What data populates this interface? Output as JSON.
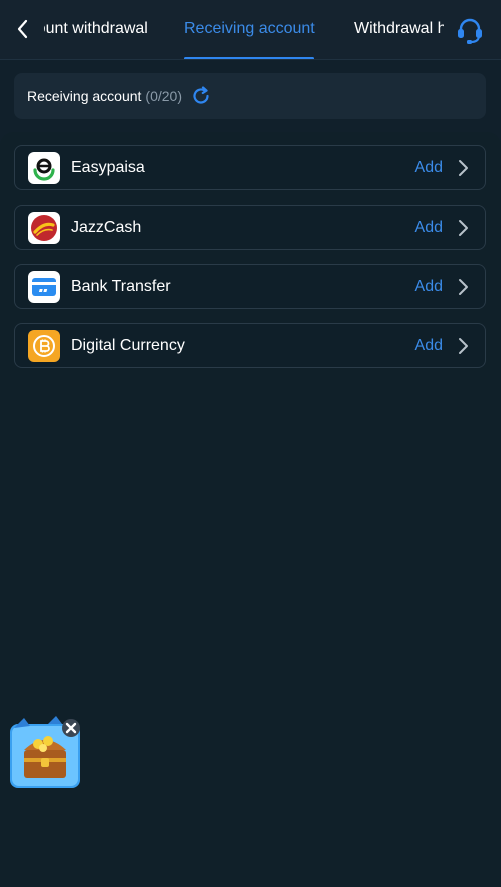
{
  "header": {
    "tabs": [
      {
        "label": "Account withdrawal"
      },
      {
        "label": "Receiving account"
      },
      {
        "label": "Withdrawal history"
      }
    ],
    "back_icon": "chevron-left-icon",
    "service_icon": "headset-icon"
  },
  "summary": {
    "label": "Receiving account",
    "count": "(0/20)",
    "refresh_icon": "refresh-icon"
  },
  "accounts": [
    {
      "label": "Easypaisa",
      "action": "Add",
      "icon": "easypaisa-logo"
    },
    {
      "label": "JazzCash",
      "action": "Add",
      "icon": "jazzcash-logo"
    },
    {
      "label": "Bank Transfer",
      "action": "Add",
      "icon": "bank-card-icon"
    },
    {
      "label": "Digital Currency",
      "action": "Add",
      "icon": "bitcoin-icon"
    }
  ],
  "promo": {
    "icon": "treasure-chest-icon"
  },
  "colors": {
    "accent": "#3b8be8",
    "background": "#11202b"
  }
}
